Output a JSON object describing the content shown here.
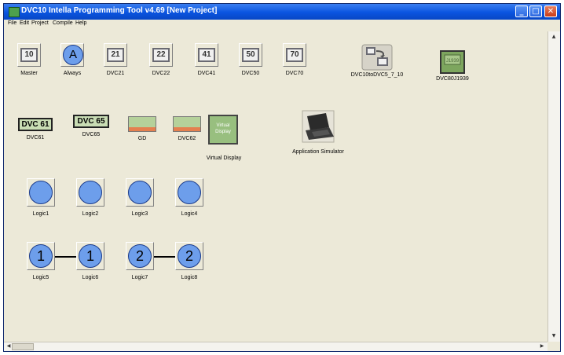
{
  "window": {
    "title": "DVC10 Intella Programming Tool v4.69 [New Project]"
  },
  "titlebar_buttons": {
    "minimize": "_",
    "maximize": "□",
    "close": "✕"
  },
  "menu": [
    "File",
    "Edit",
    "Project",
    "Compile",
    "Help"
  ],
  "blocks_row1": [
    {
      "label": "Master",
      "chip": "10"
    },
    {
      "label": "Always",
      "glyph": "A"
    },
    {
      "label": "DVC21",
      "chip": "21"
    },
    {
      "label": "DVC22",
      "chip": "22"
    },
    {
      "label": "DVC41",
      "chip": "41"
    },
    {
      "label": "DVC50",
      "chip": "50"
    },
    {
      "label": "DVC70",
      "chip": "70"
    },
    {
      "label": "DVC10toDVC5_7_10"
    },
    {
      "label": "DVC80J1939"
    }
  ],
  "blocks_row2": [
    {
      "label": "DVC61",
      "box": "DVC 61"
    },
    {
      "label": "DVC65",
      "box": "DVC 65"
    },
    {
      "label": "GD"
    },
    {
      "label": "DVC62"
    },
    {
      "label": "Virtual Display",
      "box": "Virtual Display"
    },
    {
      "label": "Application Simulator"
    }
  ],
  "logic_row1": [
    {
      "label": "Logic1"
    },
    {
      "label": "Logic2"
    },
    {
      "label": "Logic3"
    },
    {
      "label": "Logic4"
    }
  ],
  "logic_row2": [
    {
      "label": "Logic5",
      "glyph": "1"
    },
    {
      "label": "Logic6",
      "glyph": "1"
    },
    {
      "label": "Logic7",
      "glyph": "2"
    },
    {
      "label": "Logic8",
      "glyph": "2"
    }
  ],
  "colors": {
    "titlebar": "#0a54e0",
    "canvas": "#ece9d8",
    "logic_circle": "#6d9eeb"
  }
}
